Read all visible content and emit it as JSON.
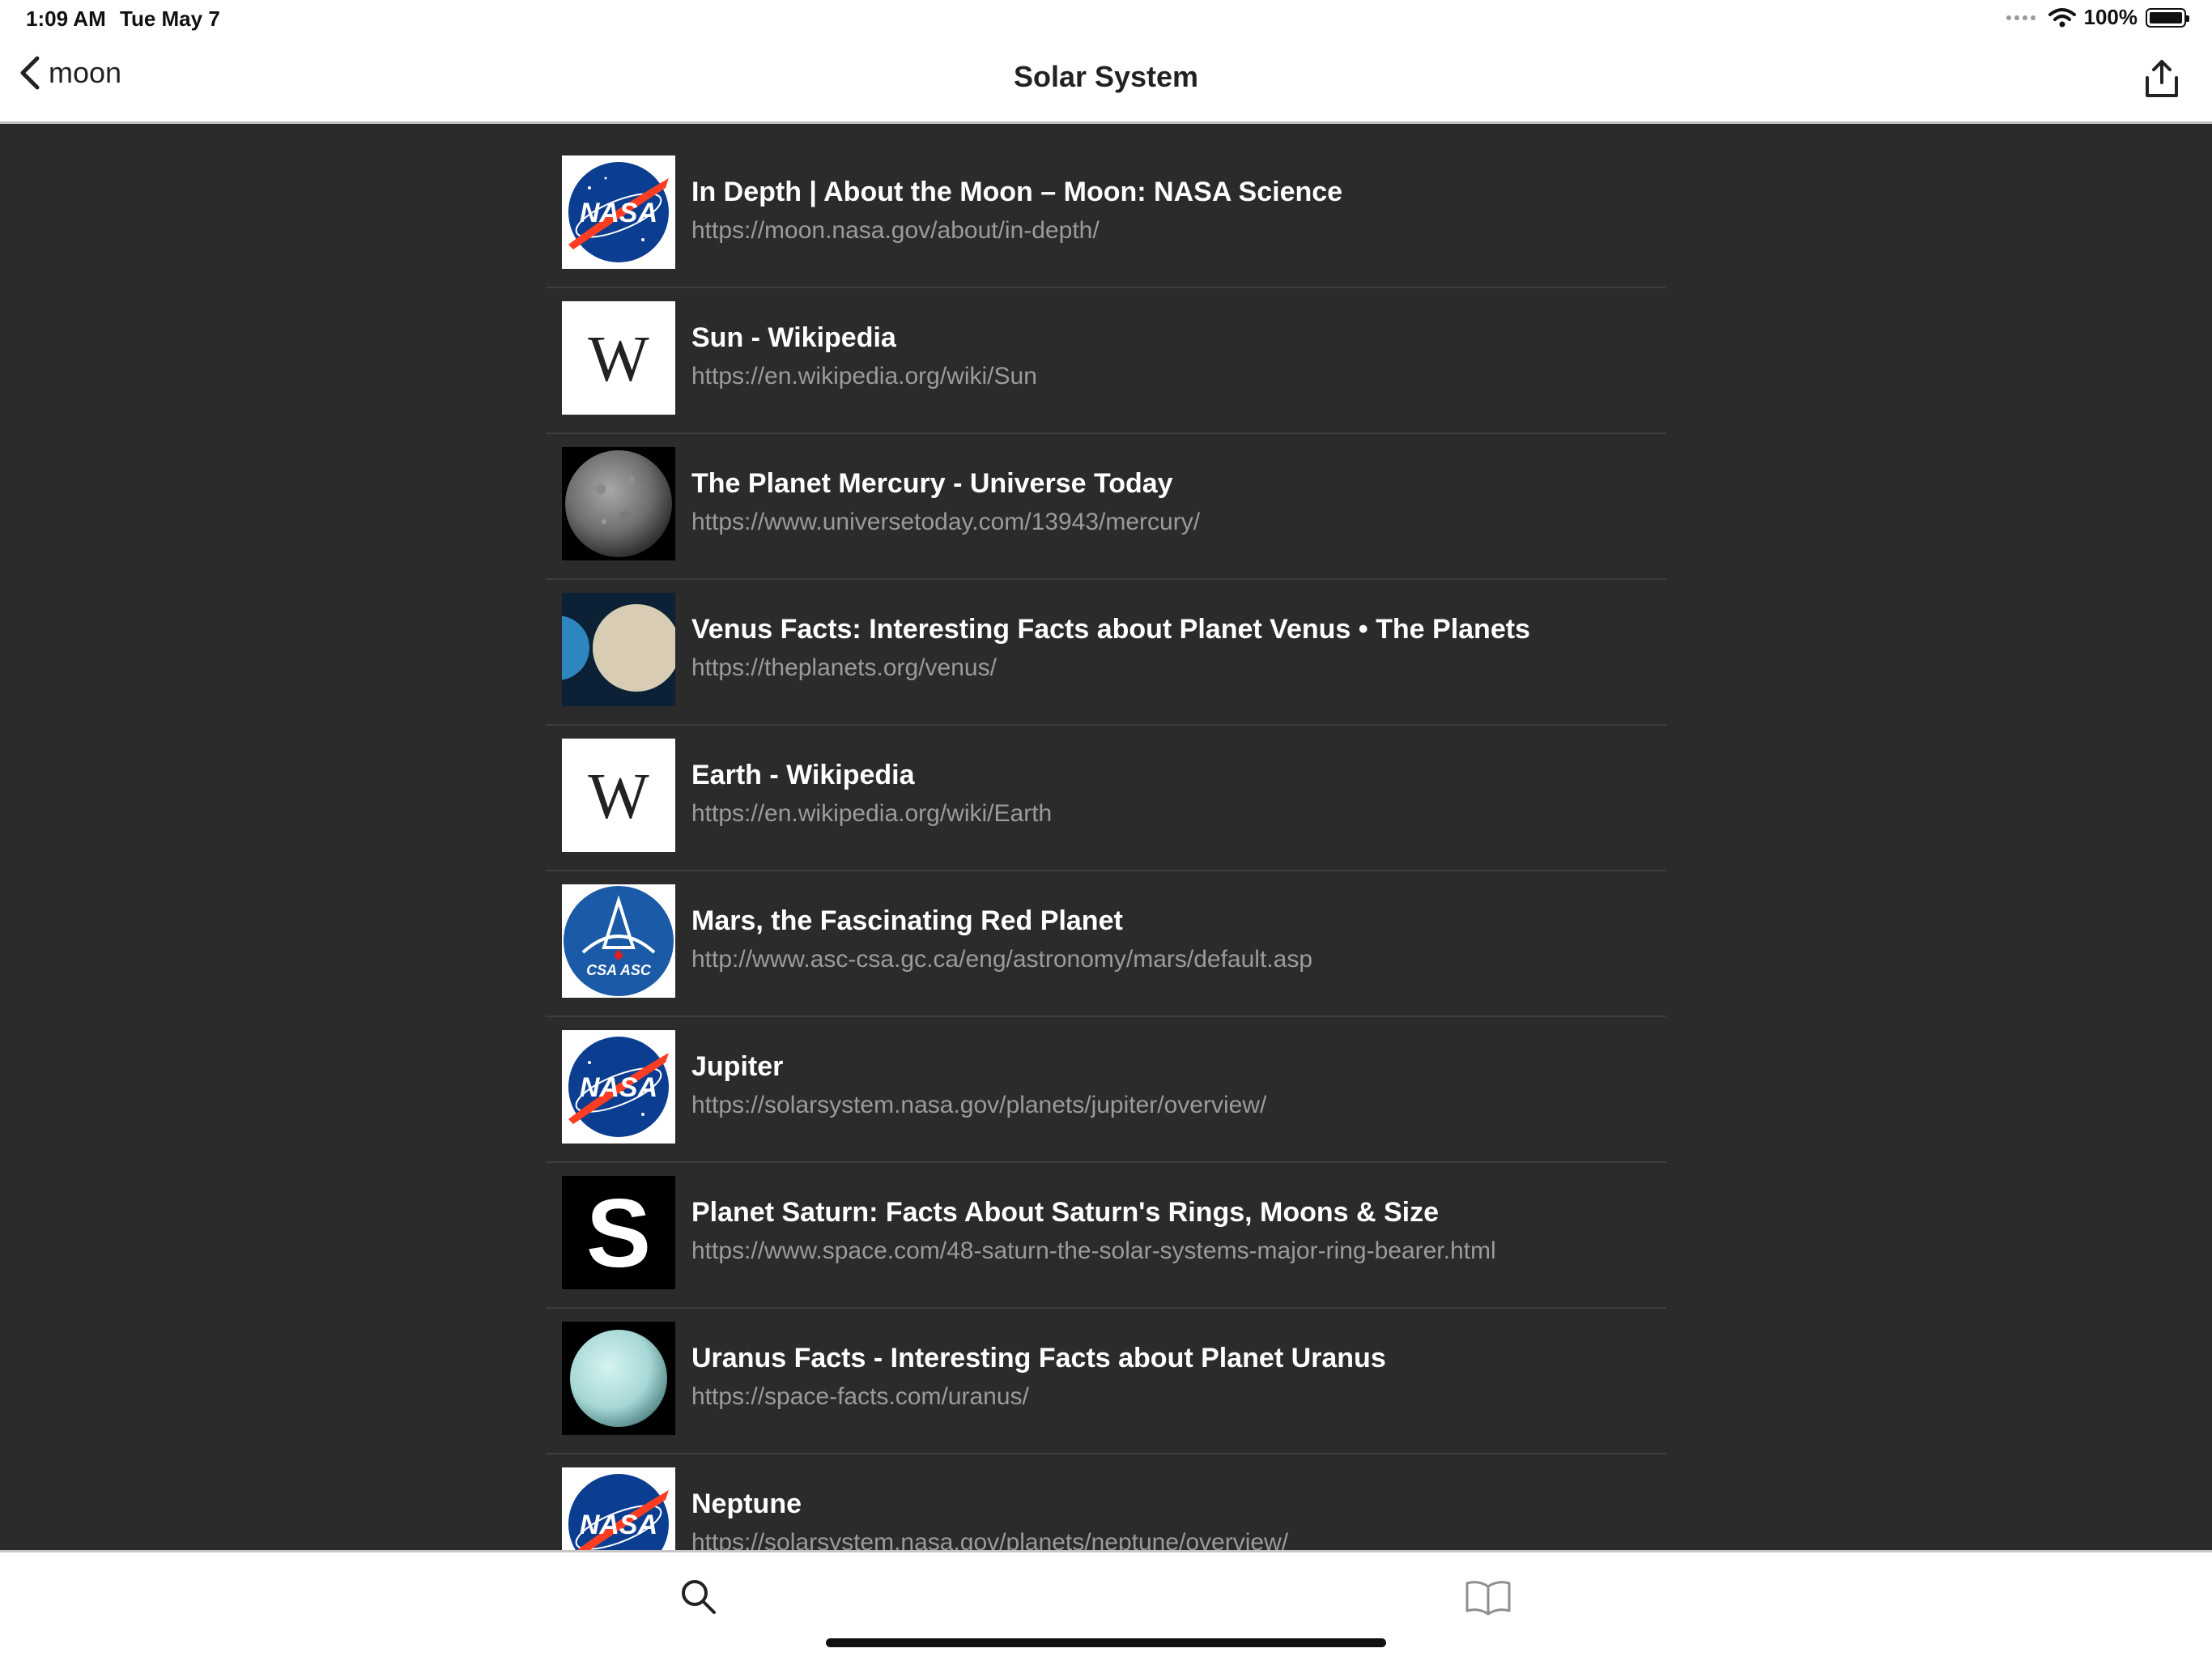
{
  "status": {
    "time": "1:09 AM",
    "date": "Tue May 7",
    "battery": "100%"
  },
  "nav": {
    "back_label": "moon",
    "title": "Solar System"
  },
  "list": [
    {
      "title": "In Depth | About the Moon – Moon: NASA Science",
      "url": "https://moon.nasa.gov/about/in-depth/",
      "icon": "nasa-logo-icon"
    },
    {
      "title": "Sun - Wikipedia",
      "url": "https://en.wikipedia.org/wiki/Sun",
      "icon": "wikipedia-logo-icon"
    },
    {
      "title": "The Planet Mercury - Universe Today",
      "url": "https://www.universetoday.com/13943/mercury/",
      "icon": "mercury-planet-icon"
    },
    {
      "title": "Venus Facts: Interesting Facts about Planet Venus • The Planets",
      "url": "https://theplanets.org/venus/",
      "icon": "venus-planet-icon"
    },
    {
      "title": "Earth - Wikipedia",
      "url": "https://en.wikipedia.org/wiki/Earth",
      "icon": "wikipedia-logo-icon"
    },
    {
      "title": "Mars, the Fascinating Red Planet",
      "url": "http://www.asc-csa.gc.ca/eng/astronomy/mars/default.asp",
      "icon": "csa-asc-logo-icon"
    },
    {
      "title": "Jupiter",
      "url": "https://solarsystem.nasa.gov/planets/jupiter/overview/",
      "icon": "nasa-logo-icon"
    },
    {
      "title": "Planet Saturn: Facts About Saturn's Rings, Moons & Size",
      "url": "https://www.space.com/48-saturn-the-solar-systems-major-ring-bearer.html",
      "icon": "space-com-logo-icon"
    },
    {
      "title": "Uranus Facts - Interesting Facts about Planet Uranus",
      "url": "https://space-facts.com/uranus/",
      "icon": "uranus-planet-icon"
    },
    {
      "title": "Neptune",
      "url": "https://solarsystem.nasa.gov/planets/neptune/overview/",
      "icon": "nasa-logo-icon"
    }
  ],
  "tabs": [
    {
      "icon": "search-icon"
    },
    {
      "icon": "book-icon"
    }
  ],
  "logo_text": {
    "nasa": "NASA",
    "wikipedia": "W",
    "csa": "CSA ASC",
    "space": "S"
  },
  "colors": {
    "background": "#2b2b2b",
    "title_text": "#ffffff",
    "url_text": "#9b9b9b",
    "nasa_blue": "#0b3d91",
    "nasa_red": "#fc3d21",
    "csa_blue": "#1a5aa6"
  }
}
